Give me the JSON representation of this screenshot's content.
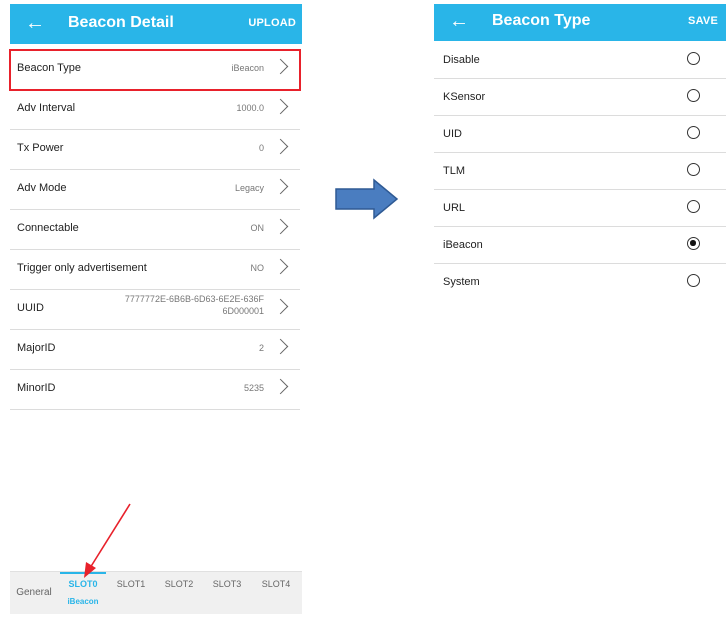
{
  "left": {
    "title": "Beacon Detail",
    "action": "UPLOAD",
    "back_icon": "arrow-left-icon",
    "rows": [
      {
        "label": "Beacon Type",
        "value": "iBeacon"
      },
      {
        "label": "Adv Interval",
        "value": "1000.0"
      },
      {
        "label": "Tx Power",
        "value": "0"
      },
      {
        "label": "Adv Mode",
        "value": "Legacy"
      },
      {
        "label": "Connectable",
        "value": "ON"
      },
      {
        "label": "Trigger only advertisement",
        "value": "NO"
      },
      {
        "label": "UUID",
        "value": "7777772E-6B6B-6D63-6E2E-636F6D000001"
      },
      {
        "label": "MajorID",
        "value": "2"
      },
      {
        "label": "MinorID",
        "value": "5235"
      }
    ],
    "tabs": [
      {
        "label": "General",
        "sub": ""
      },
      {
        "label": "SLOT0",
        "sub": "iBeacon"
      },
      {
        "label": "SLOT1",
        "sub": ""
      },
      {
        "label": "SLOT2",
        "sub": ""
      },
      {
        "label": "SLOT3",
        "sub": ""
      },
      {
        "label": "SLOT4",
        "sub": ""
      }
    ],
    "active_tab": "SLOT0"
  },
  "right": {
    "title": "Beacon Type",
    "action": "SAVE",
    "back_icon": "arrow-left-icon",
    "options": [
      {
        "label": "Disable",
        "selected": false
      },
      {
        "label": "KSensor",
        "selected": false
      },
      {
        "label": "UID",
        "selected": false
      },
      {
        "label": "TLM",
        "selected": false
      },
      {
        "label": "URL",
        "selected": false
      },
      {
        "label": "iBeacon",
        "selected": true
      },
      {
        "label": "System",
        "selected": false
      }
    ]
  },
  "colors": {
    "appbar": "#29b5e8",
    "highlight": "#e8212b",
    "annotation_arrow": "#e8212b",
    "flow_arrow": "#3d6fb3"
  }
}
